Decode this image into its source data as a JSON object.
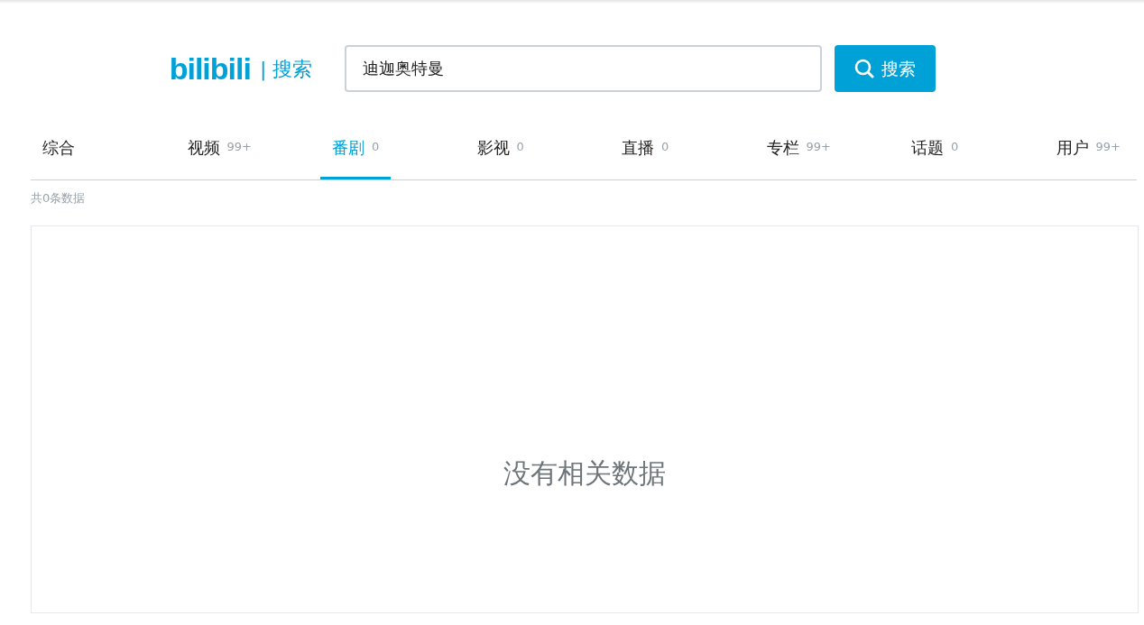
{
  "header": {
    "logo": "bilibili",
    "logo_suffix": "| 搜索",
    "search": {
      "value": "迪迦奥特曼"
    },
    "search_button": "搜索"
  },
  "tabs": [
    {
      "label": "综合",
      "selected": false
    },
    {
      "label": "视频",
      "count": "99+",
      "selected": false
    },
    {
      "label": "番剧",
      "count": "0",
      "selected": true
    },
    {
      "label": "影视",
      "count": "0",
      "selected": false
    },
    {
      "label": "直播",
      "count": "0",
      "selected": false
    },
    {
      "label": "专栏",
      "count": "99+",
      "selected": false
    },
    {
      "label": "话题",
      "count": "0",
      "selected": false
    },
    {
      "label": "用户",
      "count": "99+",
      "selected": false
    }
  ],
  "result_count": "共0条数据",
  "empty_message": "没有相关数据"
}
